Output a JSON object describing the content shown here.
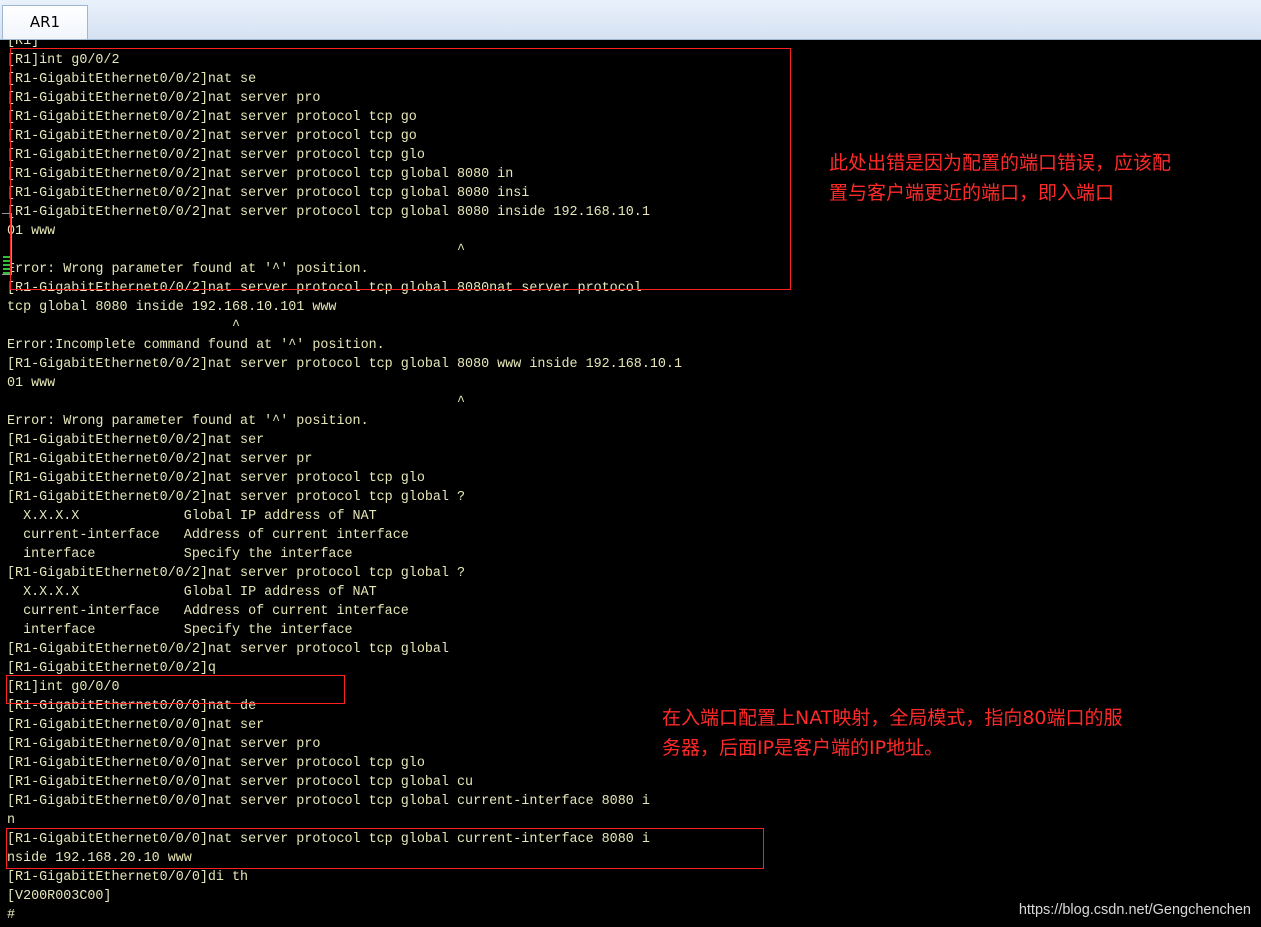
{
  "window": {
    "tab_label": "AR1"
  },
  "terminal": {
    "lines": [
      "[R1]",
      "[R1]int g0/0/2",
      "[R1-GigabitEthernet0/0/2]nat se",
      "[R1-GigabitEthernet0/0/2]nat server pro",
      "[R1-GigabitEthernet0/0/2]nat server protocol tcp go",
      "[R1-GigabitEthernet0/0/2]nat server protocol tcp go",
      "[R1-GigabitEthernet0/0/2]nat server protocol tcp glo",
      "[R1-GigabitEthernet0/0/2]nat server protocol tcp global 8080 in",
      "[R1-GigabitEthernet0/0/2]nat server protocol tcp global 8080 insi",
      "[R1-GigabitEthernet0/0/2]nat server protocol tcp global 8080 inside 192.168.10.1",
      "01 www",
      "                                                        ^",
      "Error: Wrong parameter found at '^' position.",
      "[R1-GigabitEthernet0/0/2]nat server protocol tcp global 8080nat server protocol",
      "tcp global 8080 inside 192.168.10.101 www",
      "                            ^",
      "Error:Incomplete command found at '^' position.",
      "[R1-GigabitEthernet0/0/2]nat server protocol tcp global 8080 www inside 192.168.10.1",
      "01 www",
      "                                                        ^",
      "Error: Wrong parameter found at '^' position.",
      "[R1-GigabitEthernet0/0/2]nat ser",
      "[R1-GigabitEthernet0/0/2]nat server pr",
      "[R1-GigabitEthernet0/0/2]nat server protocol tcp glo",
      "[R1-GigabitEthernet0/0/2]nat server protocol tcp global ?",
      "  X.X.X.X             Global IP address of NAT",
      "  current-interface   Address of current interface",
      "  interface           Specify the interface",
      "[R1-GigabitEthernet0/0/2]nat server protocol tcp global ?",
      "  X.X.X.X             Global IP address of NAT",
      "  current-interface   Address of current interface",
      "  interface           Specify the interface",
      "[R1-GigabitEthernet0/0/2]nat server protocol tcp global",
      "[R1-GigabitEthernet0/0/2]q",
      "[R1]int g0/0/0",
      "[R1-GigabitEthernet0/0/0]nat de",
      "[R1-GigabitEthernet0/0/0]nat ser",
      "[R1-GigabitEthernet0/0/0]nat server pro",
      "[R1-GigabitEthernet0/0/0]nat server protocol tcp glo",
      "[R1-GigabitEthernet0/0/0]nat server protocol tcp global cu",
      "[R1-GigabitEthernet0/0/0]nat server protocol tcp global current-interface 8080 i",
      "n",
      "[R1-GigabitEthernet0/0/0]nat server protocol tcp global current-interface 8080 i",
      "nside 192.168.20.10 www",
      "[R1-GigabitEthernet0/0/0]di th",
      "[V200R003C00]",
      "#"
    ]
  },
  "annotations": {
    "note1": "此处出错是因为配置的端口错误，应该配\n置与客户端更近的端口，即入端口",
    "note2": "在入端口配置上NAT映射，全局模式，指向80端口的服\n务器，后面IP是客户端的IP地址。"
  },
  "watermark": "https://blog.csdn.net/Gengchenchen",
  "colors": {
    "terminal_bg": "#000000",
    "terminal_text": "#e6e6b8",
    "annotation_red": "#ff2a2a"
  }
}
